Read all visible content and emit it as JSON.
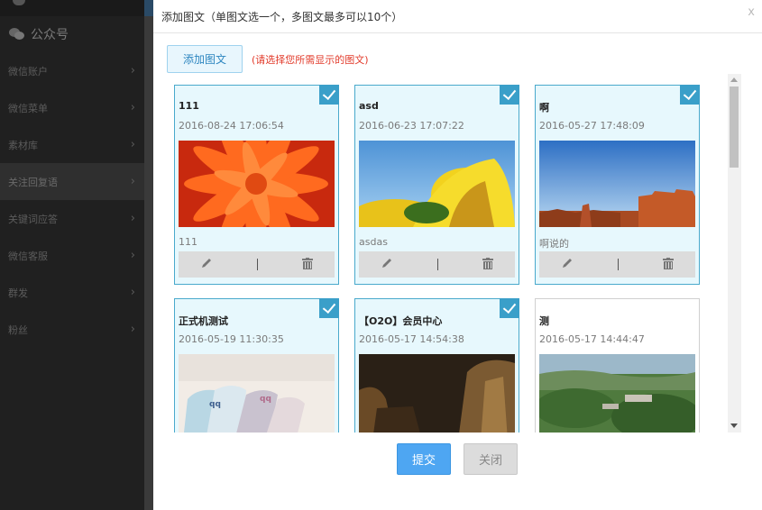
{
  "sidebar": {
    "section_title": "公众号",
    "items": [
      {
        "label": "微信账户"
      },
      {
        "label": "微信菜单"
      },
      {
        "label": "素材库"
      },
      {
        "label": "关注回复语"
      },
      {
        "label": "关键词应答"
      },
      {
        "label": "微信客服"
      },
      {
        "label": "群发"
      },
      {
        "label": "粉丝"
      }
    ],
    "chevron": "›"
  },
  "modal": {
    "title": "添加图文（单图文选一个，多图文最多可以10个）",
    "close": "x",
    "add_button": "添加图文",
    "hint": "(请选择您所需显示的图文)",
    "submit": "提交",
    "cancel": "关闭"
  },
  "cards": [
    {
      "title": "111",
      "date": "2016-08-24 17:06:54",
      "desc": "111",
      "selected": true,
      "image": "orange-flower"
    },
    {
      "title": "asd",
      "date": "2016-06-23 17:07:22",
      "desc": "asdas",
      "selected": true,
      "image": "yellow-tulips"
    },
    {
      "title": "啊",
      "date": "2016-05-27 17:48:09",
      "desc": "啊说的",
      "selected": true,
      "image": "red-rock-desert"
    },
    {
      "title": "正式机测试",
      "date": "2016-05-19 11:30:35",
      "selected": true,
      "image": "towels"
    },
    {
      "title": "【O2O】会员中心",
      "date": "2016-05-17 14:54:38",
      "selected": true,
      "image": "dark-tree"
    },
    {
      "title": "测",
      "date": "2016-05-17 14:44:47",
      "selected": false,
      "image": "aerial-landscape"
    }
  ],
  "icons": {
    "edit": "pencil-icon",
    "delete": "trash-icon",
    "check": "checkmark-icon"
  }
}
